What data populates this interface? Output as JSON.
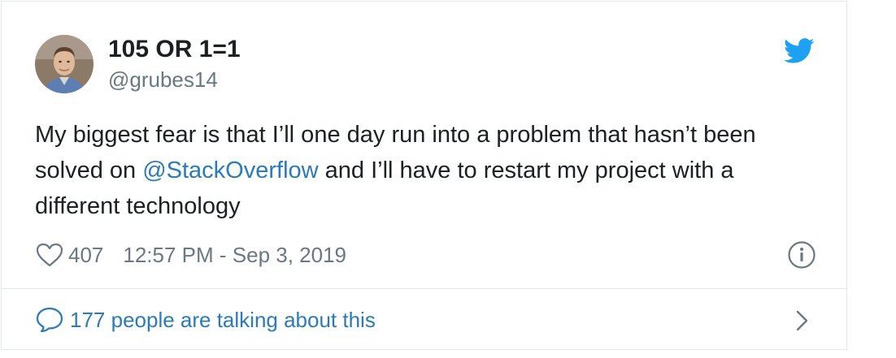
{
  "author": {
    "display_name": "105 OR 1=1",
    "handle": "@grubes14"
  },
  "tweet": {
    "text_before_mention": "My biggest fear is that I’ll one day run into a problem that hasn’t been solved on ",
    "mention": "@StackOverflow",
    "text_after_mention": " and I’ll have to restart my project with a different technology"
  },
  "meta": {
    "like_count": "407",
    "timestamp": "12:57 PM - Sep 3, 2019"
  },
  "footer": {
    "talking_label": "177 people are talking about this"
  },
  "icons": {
    "brand": "twitter-bird-icon",
    "like": "heart-icon",
    "info": "info-icon",
    "conversation": "speech-bubble-icon",
    "expand": "chevron-right-icon"
  },
  "colors": {
    "twitter_blue": "#1da1f2",
    "link_blue": "#2b7bb9",
    "text_primary": "#1c2022",
    "text_secondary": "#697882",
    "border": "#e1e8ed"
  }
}
